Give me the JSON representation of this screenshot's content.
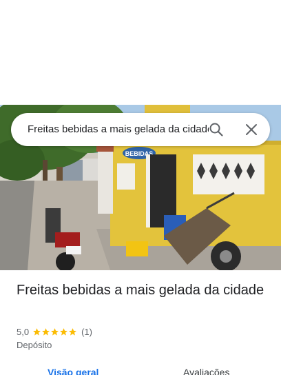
{
  "search": {
    "query": "Freitas bebidas a mais gelada da cidade"
  },
  "icons": {
    "search": "search-icon",
    "close": "close-icon",
    "star": "star-icon"
  },
  "place": {
    "title": "Freitas bebidas a mais gelada da cidade",
    "rating": "5,0",
    "stars": 5,
    "review_count": "(1)",
    "category": "Depósito",
    "sign_text": "BEBIDAS"
  },
  "tabs": [
    {
      "label": "Visão geral",
      "active": true
    },
    {
      "label": "Avaliações",
      "active": false
    }
  ],
  "colors": {
    "accent": "#1a73e8",
    "star": "#fbbc04",
    "text": "#202124",
    "muted": "#5f6368"
  }
}
